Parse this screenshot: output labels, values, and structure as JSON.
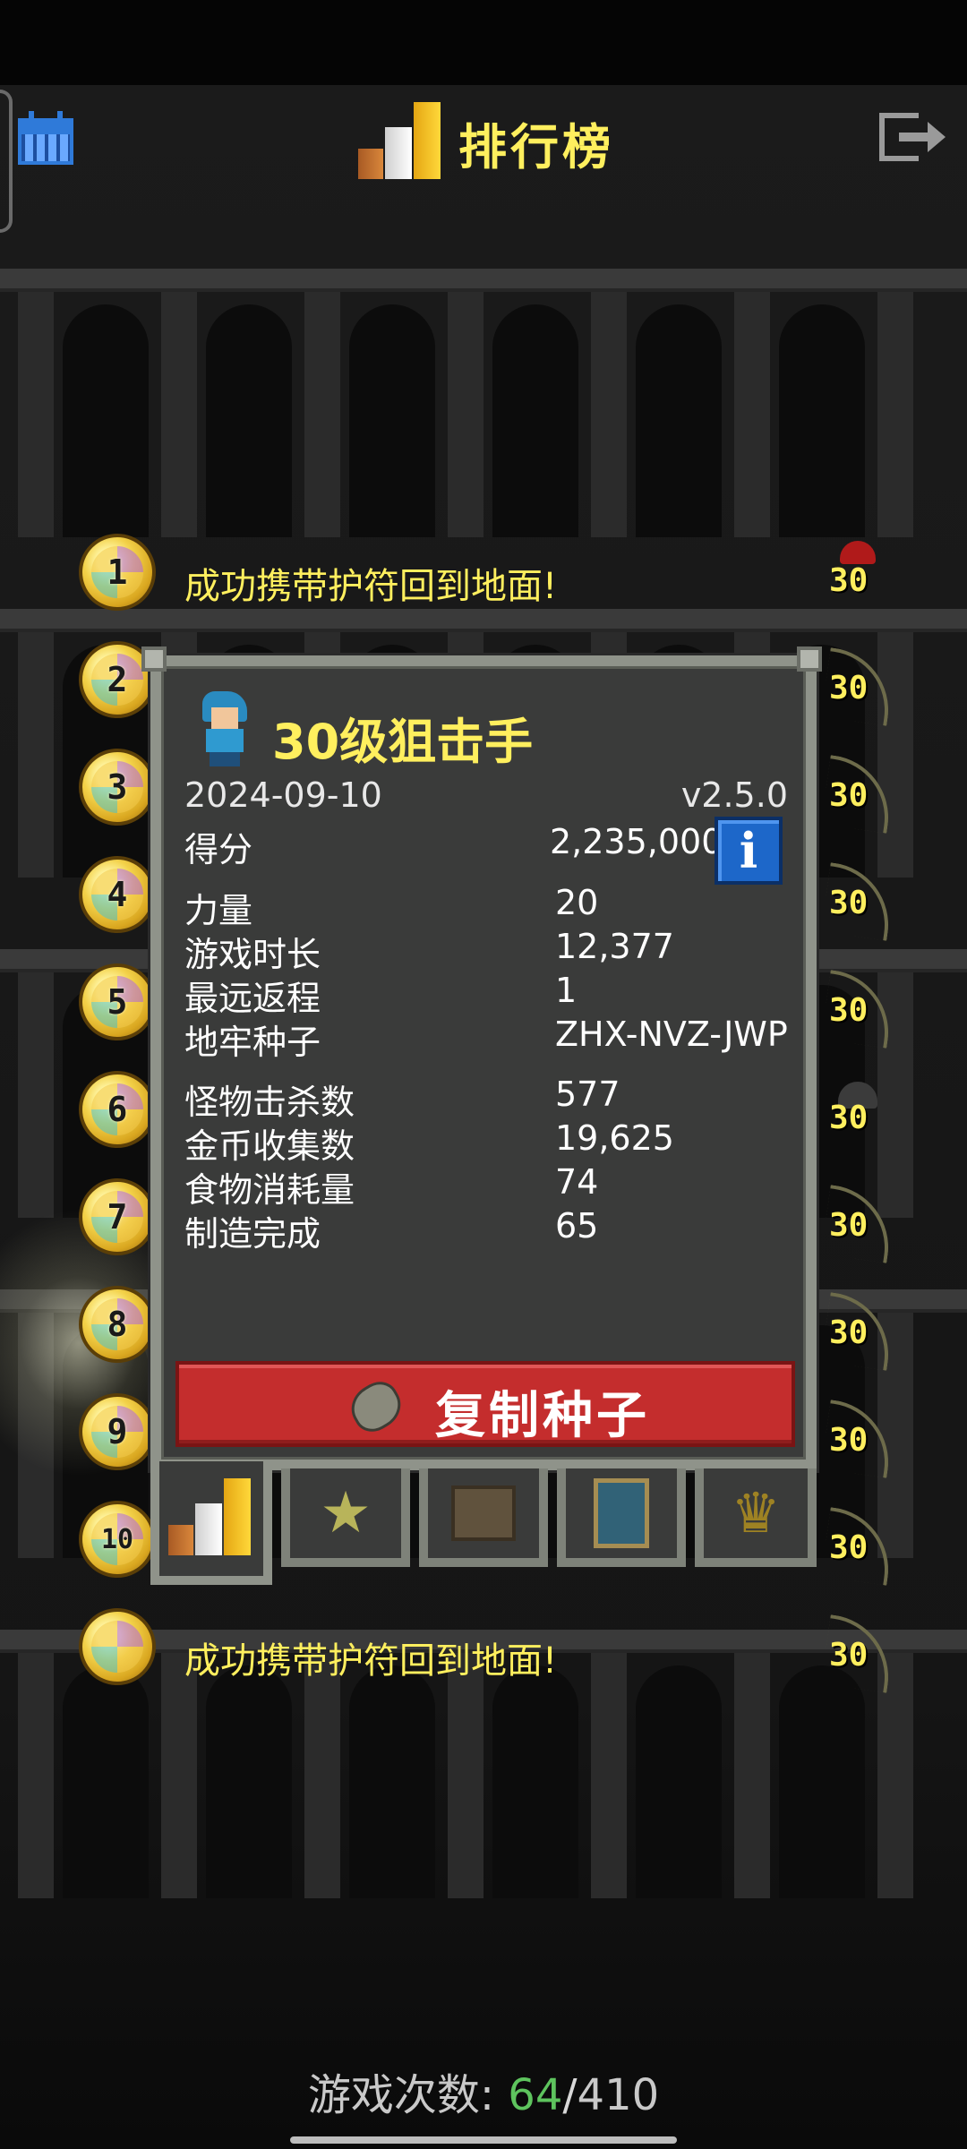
{
  "header": {
    "title": "排行榜"
  },
  "rankings": [
    {
      "rank": "1",
      "text": "成功携带护符回到地面!",
      "level": "30"
    },
    {
      "rank": "2",
      "text": "",
      "level": "30"
    },
    {
      "rank": "3",
      "text": "",
      "level": "30"
    },
    {
      "rank": "4",
      "text": "",
      "level": "30"
    },
    {
      "rank": "5",
      "text": "",
      "level": "30"
    },
    {
      "rank": "6",
      "text": "",
      "level": "30"
    },
    {
      "rank": "7",
      "text": "",
      "level": "30"
    },
    {
      "rank": "8",
      "text": "",
      "level": "30"
    },
    {
      "rank": "9",
      "text": "",
      "level": "30"
    },
    {
      "rank": "10",
      "text": "",
      "level": "30"
    },
    {
      "rank": "",
      "text": "成功携带护符回到地面!",
      "level": "30"
    }
  ],
  "detail": {
    "title": "30级狙击手",
    "date": "2024-09-10",
    "version": "v2.5.0",
    "stats": [
      {
        "label": "得分",
        "value": "2,235,000"
      },
      {
        "label": "力量",
        "value": "20"
      },
      {
        "label": "游戏时长",
        "value": "12,377"
      },
      {
        "label": "最远返程",
        "value": "1"
      },
      {
        "label": "地牢种子",
        "value": "ZHX-NVZ-JWP"
      },
      {
        "label": "怪物击杀数",
        "value": "577"
      },
      {
        "label": "金币收集数",
        "value": "19,625"
      },
      {
        "label": "食物消耗量",
        "value": "74"
      },
      {
        "label": "制造完成",
        "value": "65"
      }
    ],
    "copy_button": "复制种子"
  },
  "tabs": [
    "bar-chart-icon",
    "star-icon",
    "chest-icon",
    "card-icon",
    "trophy-icon"
  ],
  "footer": {
    "label": "游戏次数:",
    "played": "64",
    "separator": "/",
    "total": "410"
  },
  "colors": {
    "title_yellow": "#ffef5e",
    "copy_red": "#c42d2d",
    "info_blue": "#1d67c9",
    "count_green": "#5ec45e"
  }
}
